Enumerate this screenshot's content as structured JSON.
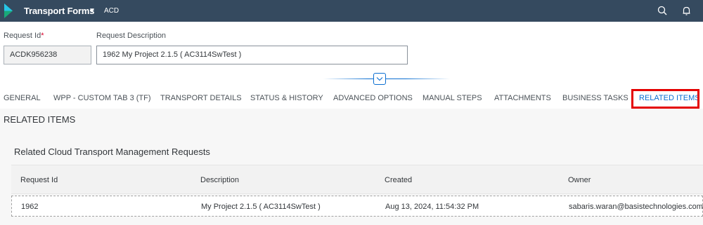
{
  "shellbar": {
    "title": "Transport Forms",
    "subtitle": "ACD",
    "icons": [
      "logo-icon",
      "chevron-down-icon",
      "search-icon",
      "bell-icon"
    ],
    "background": "#354a5f"
  },
  "form": {
    "request_id_label": "Request Id",
    "required_marker": "*",
    "request_id_value": "ACDK956238",
    "request_description_label": "Request Description",
    "request_description_value": "1962 My Project 2.1.5 ( AC3114SwTest )"
  },
  "tabs": [
    {
      "label": "GENERAL"
    },
    {
      "label": "WPP - CUSTOM TAB 3 (TF)"
    },
    {
      "label": "TRANSPORT DETAILS"
    },
    {
      "label": "STATUS & HISTORY"
    },
    {
      "label": "ADVANCED OPTIONS"
    },
    {
      "label": "MANUAL STEPS"
    },
    {
      "label": "ATTACHMENTS"
    },
    {
      "label": "BUSINESS TASKS"
    },
    {
      "label": "RELATED ITEMS",
      "selected": true
    }
  ],
  "colors": {
    "accent": "#0a6ed1",
    "highlight": "#e40000",
    "required": "#d9002a"
  },
  "content": {
    "section_title": "RELATED ITEMS",
    "panel_title": "Related Cloud Transport Management Requests",
    "columns": [
      "Request Id",
      "Description",
      "Created",
      "Owner"
    ],
    "rows": [
      [
        "1962",
        "My Project 2.1.5 ( AC3114SwTest )",
        "Aug 13, 2024, 11:54:32 PM",
        "sabaris.waran@basistechnologies.com"
      ]
    ]
  }
}
